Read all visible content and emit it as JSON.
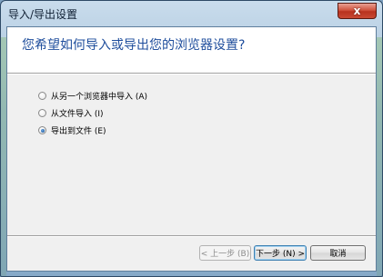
{
  "window": {
    "title": "导入/导出设置",
    "close_label": "x"
  },
  "header": {
    "heading": "您希望如何导入或导出您的浏览器设置?"
  },
  "options": [
    {
      "label": "从另一个浏览器中导入 (A)",
      "checked": false
    },
    {
      "label": "从文件导入 (I)",
      "checked": false
    },
    {
      "label": "导出到文件 (E)",
      "checked": true
    }
  ],
  "buttons": {
    "back": "< 上一步 (B)",
    "next": "下一步 (N) >",
    "cancel": "取消"
  }
}
